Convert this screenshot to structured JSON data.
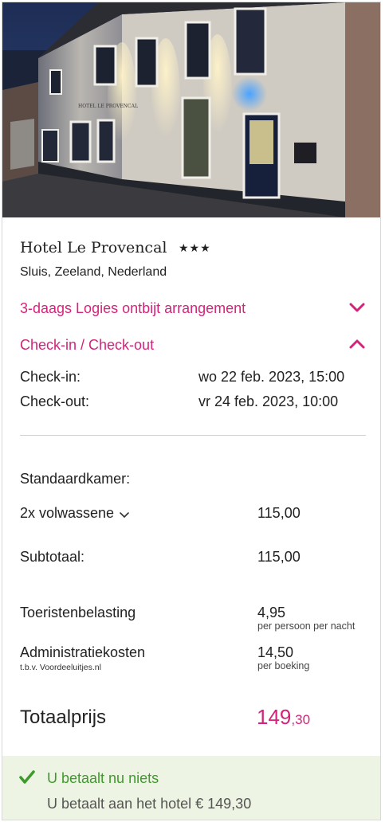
{
  "hotel": {
    "name": "Hotel Le Provencal",
    "stars": "★★★",
    "location": "Sluis, Zeeland, Nederland",
    "facade_sign": "HOTEL LE PROVENCAL"
  },
  "arrangement": {
    "label": "3-daags Logies ontbijt arrangement",
    "icon": "chevron-down-icon"
  },
  "checkinout": {
    "label": "Check-in / Check-out",
    "icon": "chevron-up-icon",
    "checkin_label": "Check-in:",
    "checkin_value": "wo 22 feb. 2023, 15:00",
    "checkout_label": "Check-out:",
    "checkout_value": "vr 24 feb. 2023, 10:00"
  },
  "pricing": {
    "room_type": "Standaardkamer:",
    "guests_label": "2x volwassene",
    "guests_price": "115,00",
    "subtotal_label": "Subtotaal:",
    "subtotal_value": "115,00",
    "tax_label": "Toeristenbelasting",
    "tax_value": "4,95",
    "tax_note": "per persoon per nacht",
    "admin_label": "Administratiekosten",
    "admin_sub": "t.b.v. Voordeeluitjes.nl",
    "admin_value": "14,50",
    "admin_note": "per boeking",
    "total_label": "Totaalprijs",
    "total_int": "149",
    "total_dec": ",30"
  },
  "payment": {
    "pay_now": "U betaalt nu niets",
    "pay_hotel": "U betaalt aan het hotel € 149,30"
  },
  "colors": {
    "accent": "#d4237a",
    "success": "#3e9a2b",
    "pay_box_bg": "#eef4e4"
  }
}
